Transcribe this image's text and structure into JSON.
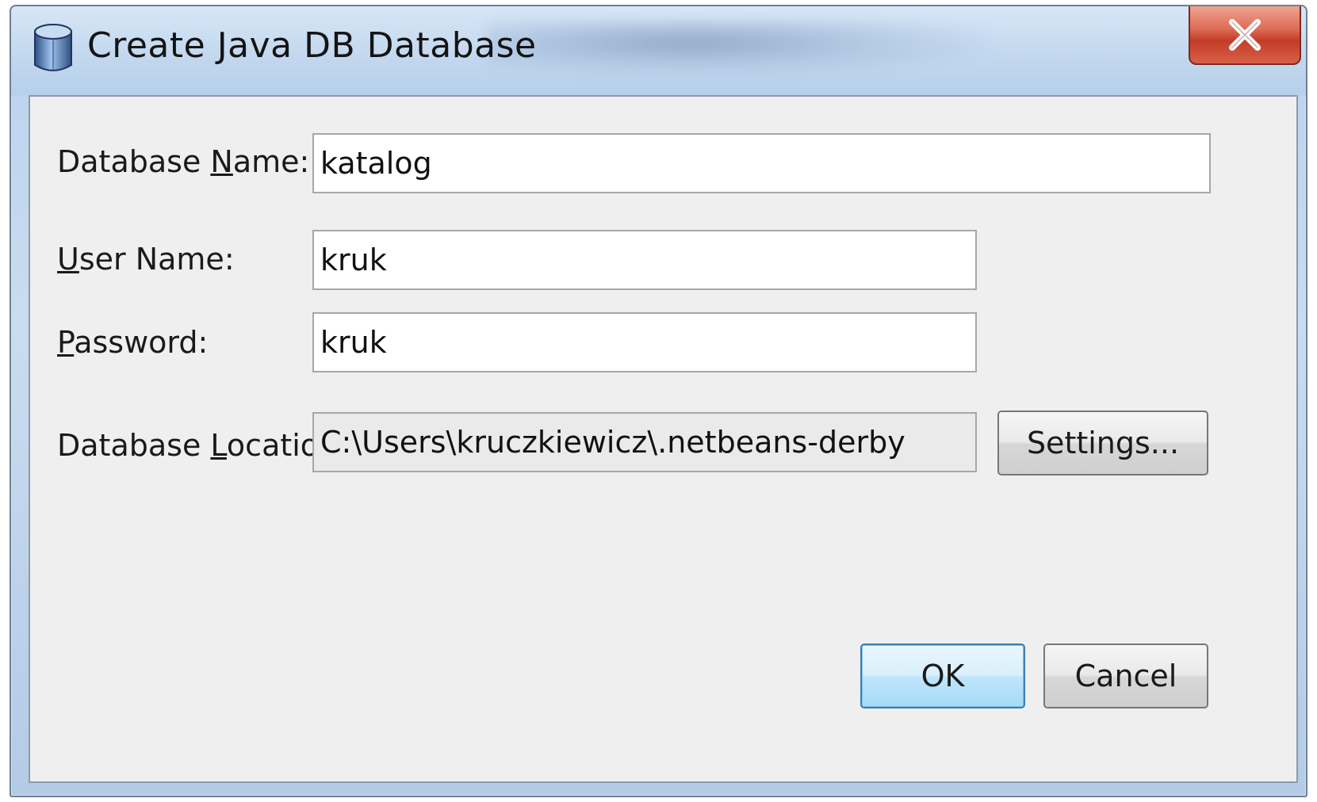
{
  "window": {
    "title": "Create Java DB Database",
    "icon": "database-cylinder-icon",
    "close_icon": "close-x-icon"
  },
  "form": {
    "database_name": {
      "label_pre": "Database ",
      "label_mnemonic": "N",
      "label_post": "ame:",
      "value": "katalog"
    },
    "user_name": {
      "label_pre": "",
      "label_mnemonic": "U",
      "label_post": "ser Name:",
      "value": "kruk"
    },
    "password": {
      "label_pre": "",
      "label_mnemonic": "P",
      "label_post": "assword:",
      "value": "kruk"
    },
    "database_location": {
      "label_pre": "Database ",
      "label_mnemonic": "L",
      "label_post": "ocation:",
      "value": "C:\\Users\\kruczkiewicz\\.netbeans-derby"
    }
  },
  "buttons": {
    "settings": "Settings...",
    "ok": "OK",
    "cancel": "Cancel"
  },
  "colors": {
    "title_bar": "#c3d8ef",
    "dialog_bg": "#efefef",
    "close_button": "#c33c27",
    "default_button": "#bee6fd"
  }
}
